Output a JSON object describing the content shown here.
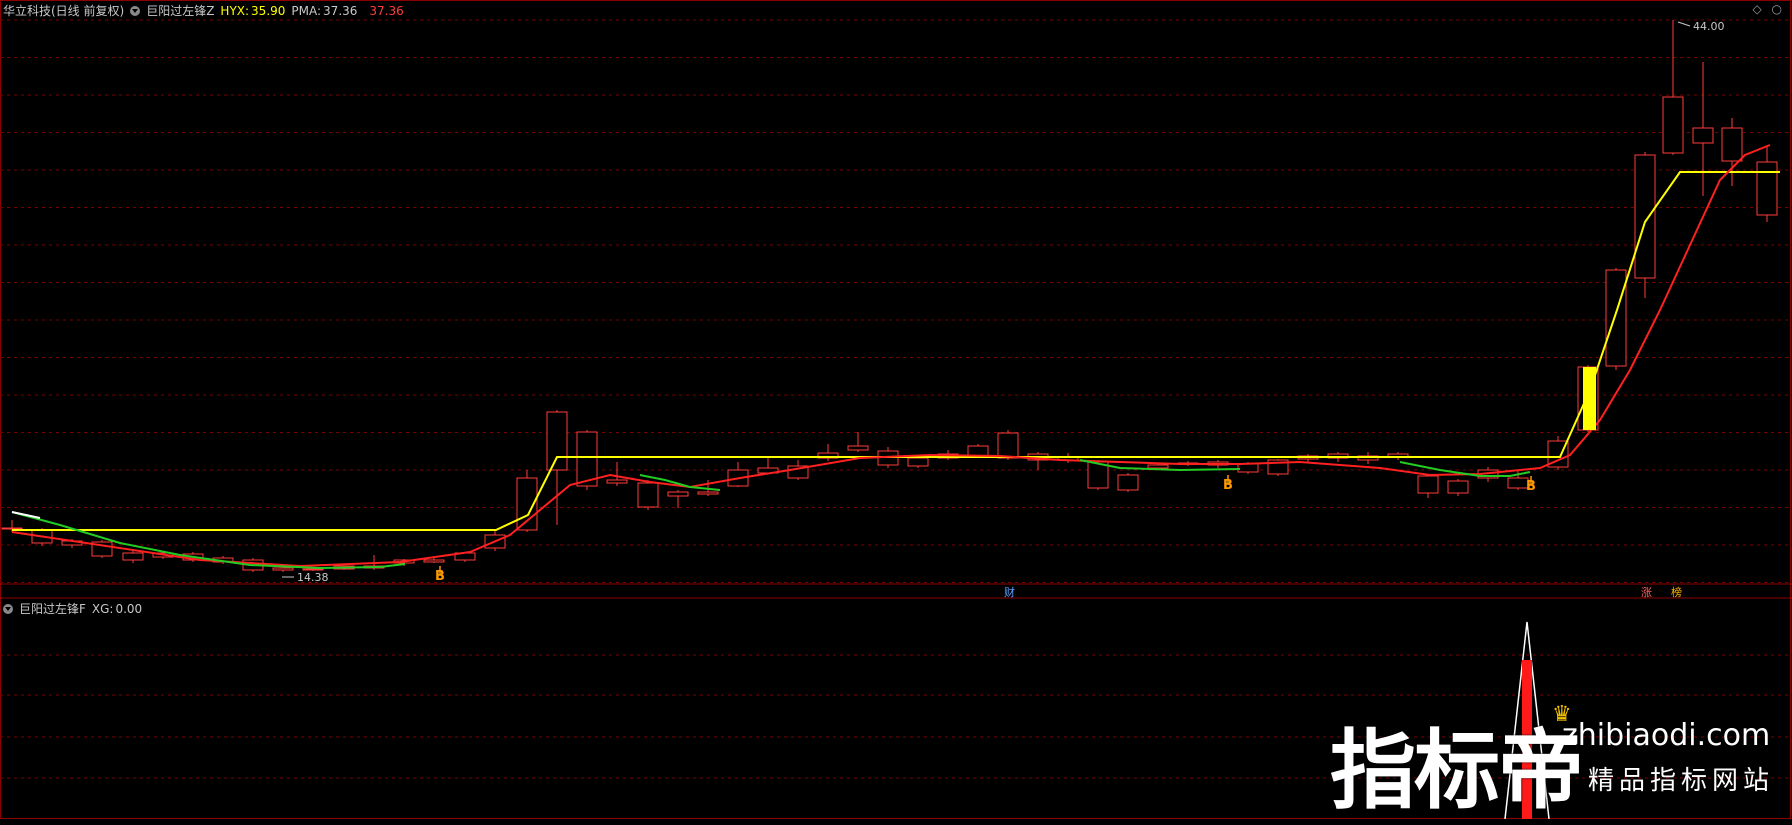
{
  "header": {
    "stock": "华立科技(日线 前复权)",
    "indicator_name": "巨阳过左锋Z",
    "hyx_label": "HYX:",
    "hyx_value": "35.90",
    "pma_label": "PMA:",
    "pma_value": "37.36",
    "extra_value": "37.36"
  },
  "sub_header": {
    "indicator_name": "巨阳过左锋F",
    "xg_label": "XG:",
    "xg_value": "0.00"
  },
  "top_right_icons": [
    "diamond-icon",
    "circle-icon"
  ],
  "price_labels": {
    "high": "44.00",
    "low": "14.38"
  },
  "signals": [
    "B",
    "B",
    "B"
  ],
  "event_markers": [
    "财",
    "涨",
    "榜"
  ],
  "watermark": {
    "big": "指标帝",
    "url": "zhibiaodi.com",
    "sub": "精品指标网站"
  },
  "colors": {
    "background": "#000000",
    "up": "#ff3c3c",
    "down": "#54fcfc",
    "hyx_line": "#ffff00",
    "pma_line": "#ff2020",
    "green_line": "#22cc22",
    "signal": "#ff9900",
    "grid": "#7a0000"
  }
}
